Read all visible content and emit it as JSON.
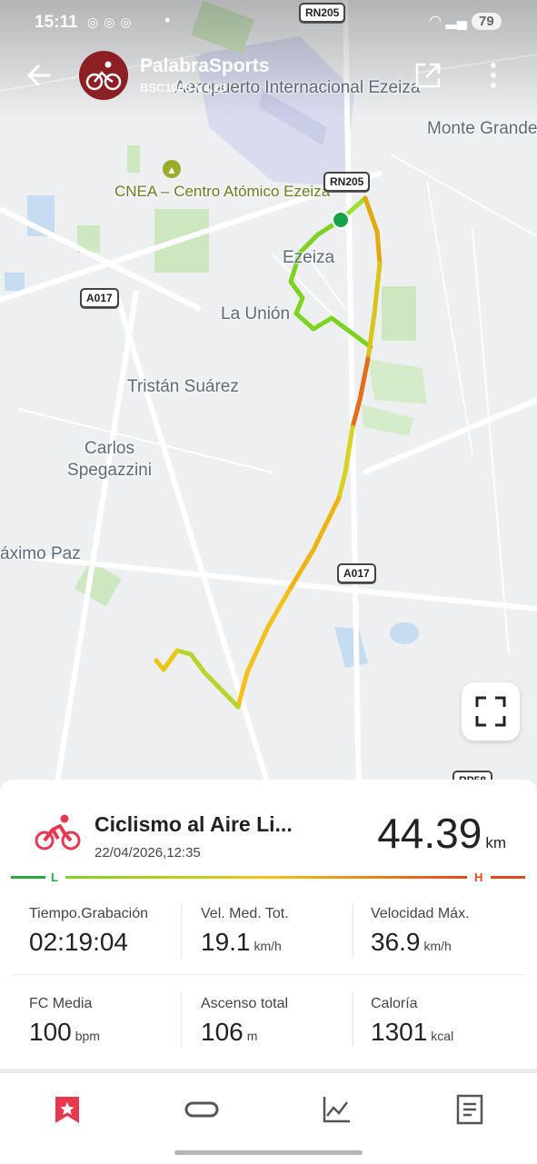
{
  "status_bar": {
    "time": "15:11",
    "battery": "79"
  },
  "app_bar": {
    "title": "PalabraSports",
    "subtitle": "BSC100S V4.23"
  },
  "map": {
    "labels": {
      "airport": "Aeropuerto Internacional Ezeiza",
      "monte_grande": "Monte Grande",
      "cnea": "CNEA – Centro Atómico Ezeiza",
      "ezeiza": "Ezeiza",
      "la_union": "La Unión",
      "tristan_suarez": "Tristán Suárez",
      "carlos_spegazzini": "Carlos Spegazzini",
      "maximo_paz": "áximo Paz"
    },
    "roads": {
      "rn205_top": "RN205",
      "rn205_mid": "RN205",
      "a017_left": "A017",
      "a017_right": "A017",
      "rp58": "RP58"
    }
  },
  "activity": {
    "title": "Ciclismo al Aire Li...",
    "datetime": "22/04/2026,12:35",
    "distance": "44.39",
    "distance_unit": "km",
    "scale_low": "L",
    "scale_high": "H"
  },
  "stats": [
    {
      "label": "Tiempo.Grabación",
      "value": "02:19:04",
      "unit": ""
    },
    {
      "label": "Vel. Med. Tot.",
      "value": "19.1",
      "unit": "km/h"
    },
    {
      "label": "Velocidad Máx.",
      "value": "36.9",
      "unit": "km/h"
    },
    {
      "label": "FC Media",
      "value": "100",
      "unit": "bpm"
    },
    {
      "label": "Ascenso total",
      "value": "106",
      "unit": "m"
    },
    {
      "label": "Caloría",
      "value": "1301",
      "unit": "kcal"
    }
  ],
  "icons": {
    "back": "back-arrow-icon",
    "share": "share-icon",
    "more": "more-vert-icon",
    "fullscreen": "fullscreen-icon",
    "activity": "cycling-icon",
    "tabs": [
      "bookmark-icon",
      "lap-icon",
      "chart-icon",
      "document-icon"
    ]
  },
  "colors": {
    "accent": "#e8374e",
    "route_low": "#7ed321",
    "route_high": "#e04a1e"
  }
}
